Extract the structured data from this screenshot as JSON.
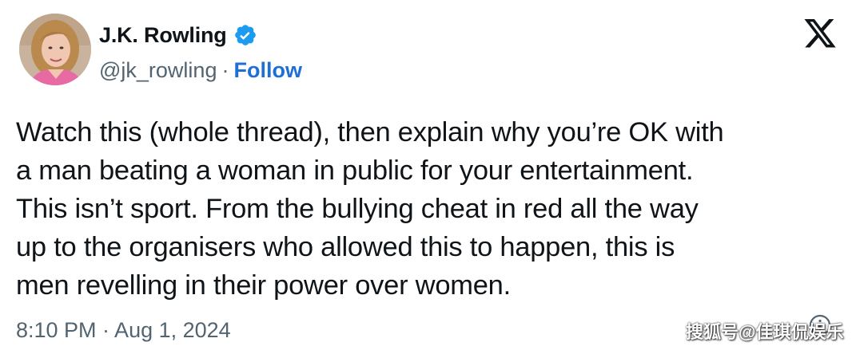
{
  "author": {
    "name": "J.K. Rowling",
    "handle": "@jk_rowling",
    "separator": "·",
    "follow_label": "Follow",
    "verified": true
  },
  "tweet": {
    "text": "Watch this (whole thread), then explain why you’re OK with\na man beating a woman in public for your entertainment.\nThis isn’t sport. From the bullying cheat in red all the way\nup to the organisers who allowed this to happen, this is\nmen revelling in their power over women.",
    "timestamp": "8:10 PM · Aug 1, 2024"
  },
  "icons": {
    "brand": "x-logo-icon",
    "verified": "verified-badge-icon",
    "info": "info-icon"
  },
  "colors": {
    "text": "#0f1419",
    "secondary": "#536471",
    "link": "#1d6fd6",
    "verified": "#1d9bf0"
  },
  "watermark": {
    "text": "搜狐号@佳琪侃娱乐"
  }
}
